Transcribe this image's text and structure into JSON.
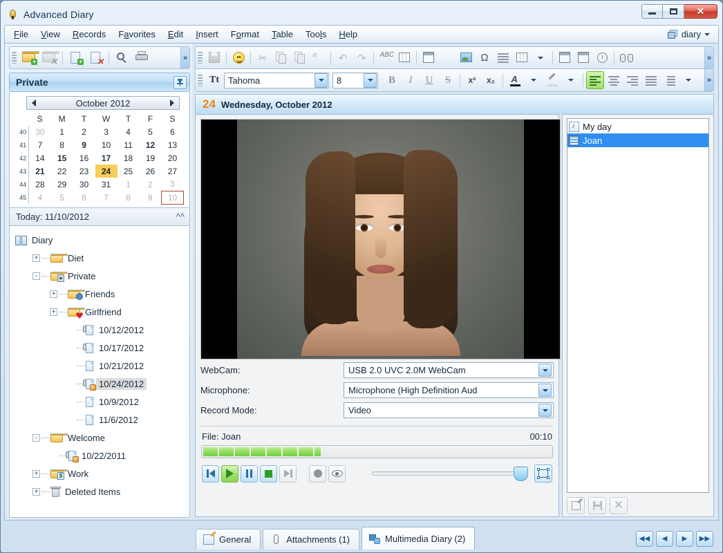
{
  "window": {
    "title": "Advanced Diary",
    "app_icon": "pen-nib-icon",
    "buttons": {
      "minimize": "minimize-button",
      "maximize": "maximize-button",
      "close": "✕"
    }
  },
  "menubar": {
    "items": [
      {
        "label": "File",
        "accel": "F"
      },
      {
        "label": "View",
        "accel": "V"
      },
      {
        "label": "Records",
        "accel": "R"
      },
      {
        "label": "Favorites",
        "accel": "a"
      },
      {
        "label": "Edit",
        "accel": "E"
      },
      {
        "label": "Insert",
        "accel": "I"
      },
      {
        "label": "Format",
        "accel": "o"
      },
      {
        "label": "Table",
        "accel": "T"
      },
      {
        "label": "Tools",
        "accel": "l"
      },
      {
        "label": "Help",
        "accel": "H"
      }
    ],
    "diary_chooser": "diary"
  },
  "left_toolbar": {
    "buttons": [
      {
        "name": "new-folder-button",
        "icon": "folder-add-icon"
      },
      {
        "name": "delete-folder-button",
        "icon": "folder-delete-icon"
      },
      {
        "name": "new-record-button",
        "icon": "page-add-icon"
      },
      {
        "name": "delete-record-button",
        "icon": "page-delete-icon"
      },
      {
        "name": "search-button",
        "icon": "magnifier-icon"
      },
      {
        "name": "print-button",
        "icon": "printer-icon"
      }
    ],
    "overflow": "»"
  },
  "format_toolbar_1": {
    "buttons": [
      {
        "name": "save-button",
        "icon": "floppy-icon"
      },
      {
        "name": "emoticon-button",
        "icon": "smiley-icon"
      },
      {
        "name": "cut-button",
        "icon": "scissors-icon"
      },
      {
        "name": "copy-button",
        "icon": "copy-icon"
      },
      {
        "name": "paste-button",
        "icon": "paste-icon"
      },
      {
        "name": "paste-special-button",
        "icon": "paste-text-icon"
      },
      {
        "name": "undo-button",
        "icon": "undo-arrow-icon"
      },
      {
        "name": "redo-button",
        "icon": "redo-arrow-icon"
      },
      {
        "name": "spellcheck-button",
        "icon": "abc-check-icon"
      },
      {
        "name": "thesaurus-button",
        "icon": "book-grid-icon"
      },
      {
        "name": "insert-textbox-button",
        "icon": "textbox-icon"
      },
      {
        "name": "insert-object-button",
        "icon": "object-icon"
      },
      {
        "name": "insert-image-button",
        "icon": "picture-icon"
      },
      {
        "name": "insert-symbol-button",
        "icon": "omega-icon"
      },
      {
        "name": "insert-hr-button",
        "icon": "lines-icon"
      },
      {
        "name": "insert-table-button",
        "icon": "table-grid-icon"
      },
      {
        "name": "insert-datetime-button",
        "icon": "calendar-clock-icon"
      },
      {
        "name": "insert-date-button",
        "icon": "calendar-icon"
      },
      {
        "name": "insert-time-button",
        "icon": "clock-icon"
      },
      {
        "name": "find-button",
        "icon": "binoculars-icon"
      }
    ],
    "overflow": "»"
  },
  "format_toolbar_2": {
    "font_name": "Tahoma",
    "font_size": "8",
    "bold": "B",
    "italic": "I",
    "underline": "U",
    "strike": "S",
    "superscript": "x²",
    "subscript": "x₂",
    "font_color_label": "A",
    "highlight_label": "highlight-icon",
    "align_left_active": true,
    "overflow": "»"
  },
  "private_panel": {
    "title": "Private",
    "pin": "pin-icon"
  },
  "calendar": {
    "month_label": "October 2012",
    "prev": "◀",
    "next": "▶",
    "weekday_headers": [
      "S",
      "M",
      "T",
      "W",
      "T",
      "F",
      "S"
    ],
    "week_numbers": [
      "40",
      "41",
      "42",
      "43",
      "44",
      "45"
    ],
    "weeks": [
      [
        {
          "d": "30",
          "s": "dim"
        },
        {
          "d": "1"
        },
        {
          "d": "2"
        },
        {
          "d": "3"
        },
        {
          "d": "4"
        },
        {
          "d": "5"
        },
        {
          "d": "6"
        }
      ],
      [
        {
          "d": "7"
        },
        {
          "d": "8"
        },
        {
          "d": "9",
          "s": "bold"
        },
        {
          "d": "10"
        },
        {
          "d": "11"
        },
        {
          "d": "12",
          "s": "bold"
        },
        {
          "d": "13"
        }
      ],
      [
        {
          "d": "14"
        },
        {
          "d": "15",
          "s": "bold"
        },
        {
          "d": "16"
        },
        {
          "d": "17",
          "s": "bold"
        },
        {
          "d": "18"
        },
        {
          "d": "19"
        },
        {
          "d": "20"
        }
      ],
      [
        {
          "d": "21",
          "s": "bold"
        },
        {
          "d": "22"
        },
        {
          "d": "23"
        },
        {
          "d": "24",
          "s": "sel"
        },
        {
          "d": "25"
        },
        {
          "d": "26"
        },
        {
          "d": "27"
        }
      ],
      [
        {
          "d": "28"
        },
        {
          "d": "29"
        },
        {
          "d": "30"
        },
        {
          "d": "31"
        },
        {
          "d": "1",
          "s": "dim"
        },
        {
          "d": "2",
          "s": "dim"
        },
        {
          "d": "3",
          "s": "dim"
        }
      ],
      [
        {
          "d": "4",
          "s": "dim"
        },
        {
          "d": "5",
          "s": "dim"
        },
        {
          "d": "6",
          "s": "dim"
        },
        {
          "d": "7",
          "s": "dim"
        },
        {
          "d": "8",
          "s": "dim"
        },
        {
          "d": "9",
          "s": "dim"
        },
        {
          "d": "10",
          "s": "dim today-mark"
        }
      ]
    ]
  },
  "today_bar": {
    "label": "Today: 11/10/2012",
    "collapse": "chevron-up-icon"
  },
  "tree": {
    "nodes": [
      {
        "label": "Diary",
        "indent": 0,
        "exp": "",
        "icon": "book",
        "sel": false
      },
      {
        "label": "Diet",
        "indent": 1,
        "exp": "+",
        "icon": "folder",
        "sel": false
      },
      {
        "label": "Private",
        "indent": 1,
        "exp": "-",
        "icon": "folder-lock",
        "sel": false
      },
      {
        "label": "Friends",
        "indent": 2,
        "exp": "+",
        "icon": "folder-people",
        "sel": false
      },
      {
        "label": "Girlfriend",
        "indent": 2,
        "exp": "+",
        "icon": "folder-heart",
        "sel": false
      },
      {
        "label": "10/12/2012",
        "indent": 3,
        "exp": "",
        "icon": "doc-clip",
        "sel": false
      },
      {
        "label": "10/17/2012",
        "indent": 3,
        "exp": "",
        "icon": "doc-clip",
        "sel": false
      },
      {
        "label": "10/21/2012",
        "indent": 3,
        "exp": "",
        "icon": "doc",
        "sel": false
      },
      {
        "label": "10/24/2012",
        "indent": 3,
        "exp": "",
        "icon": "doc-media",
        "sel": true
      },
      {
        "label": "10/9/2012",
        "indent": 3,
        "exp": "",
        "icon": "doc",
        "sel": false
      },
      {
        "label": "11/6/2012",
        "indent": 3,
        "exp": "",
        "icon": "doc",
        "sel": false
      },
      {
        "label": "Welcome",
        "indent": 1,
        "exp": "-",
        "icon": "folder",
        "sel": false
      },
      {
        "label": "10/22/2011",
        "indent": 2,
        "exp": "",
        "icon": "doc-media",
        "sel": false
      },
      {
        "label": "Work",
        "indent": 1,
        "exp": "+",
        "icon": "folder-money",
        "sel": false
      },
      {
        "label": "Deleted Items",
        "indent": 1,
        "exp": "+",
        "icon": "trash",
        "sel": false
      }
    ]
  },
  "record_header": {
    "day": "24",
    "title": "Wednesday, October 2012"
  },
  "multimedia": {
    "video_preview": "webcam-video-preview",
    "fields": [
      {
        "label": "WebCam:",
        "value": "USB 2.0 UVC 2.0M WebCam",
        "name": "webcam-select"
      },
      {
        "label": "Microphone:",
        "value": "Microphone (High Definition Aud",
        "name": "microphone-select"
      },
      {
        "label": "Record Mode:",
        "value": "Video",
        "name": "record-mode-select"
      }
    ],
    "file_label": "File: Joan",
    "duration": "00:10",
    "progress_segments": 7,
    "transport": [
      {
        "name": "previous-button",
        "icon": "skip-back-icon",
        "state": "normal"
      },
      {
        "name": "play-button",
        "icon": "play-icon",
        "state": "active"
      },
      {
        "name": "pause-button",
        "icon": "pause-icon",
        "state": "normal"
      },
      {
        "name": "stop-button",
        "icon": "stop-icon",
        "state": "normal"
      },
      {
        "name": "next-button",
        "icon": "skip-forward-icon",
        "state": "disabled"
      },
      {
        "name": "record-button",
        "icon": "record-dot-icon",
        "state": "disabled"
      },
      {
        "name": "preview-button",
        "icon": "eye-icon",
        "state": "disabled"
      }
    ],
    "volume_label": "volume-slider",
    "fullscreen": "fullscreen-icon"
  },
  "media_list": {
    "items": [
      {
        "label": "My day",
        "icon": "audio-note-icon",
        "selected": false
      },
      {
        "label": "Joan",
        "icon": "video-film-icon",
        "selected": true
      }
    ],
    "buttons": [
      {
        "name": "rename-item-button",
        "icon": "edit-icon"
      },
      {
        "name": "save-item-button",
        "icon": "floppy-icon"
      },
      {
        "name": "delete-item-button",
        "icon": "close-x-icon"
      }
    ]
  },
  "tabs": [
    {
      "label": "General",
      "icon": "note-pen-icon",
      "active": false
    },
    {
      "label": "Attachments (1)",
      "icon": "paperclip-icon",
      "active": false
    },
    {
      "label": "Multimedia Diary (2)",
      "icon": "multimedia-icon",
      "active": true
    }
  ],
  "nav_buttons": [
    {
      "name": "first-record-button",
      "glyph": "◀◀"
    },
    {
      "name": "previous-record-button",
      "glyph": "◀"
    },
    {
      "name": "next-record-button",
      "glyph": "▶"
    },
    {
      "name": "last-record-button",
      "glyph": "▶▶"
    }
  ],
  "colors": {
    "accent_orange": "#e8861c",
    "selection_blue": "#2f8ef0",
    "calendar_selected": "#f6cf5a",
    "progress_green": "#6fcf3c",
    "close_red": "#c63a2b"
  }
}
